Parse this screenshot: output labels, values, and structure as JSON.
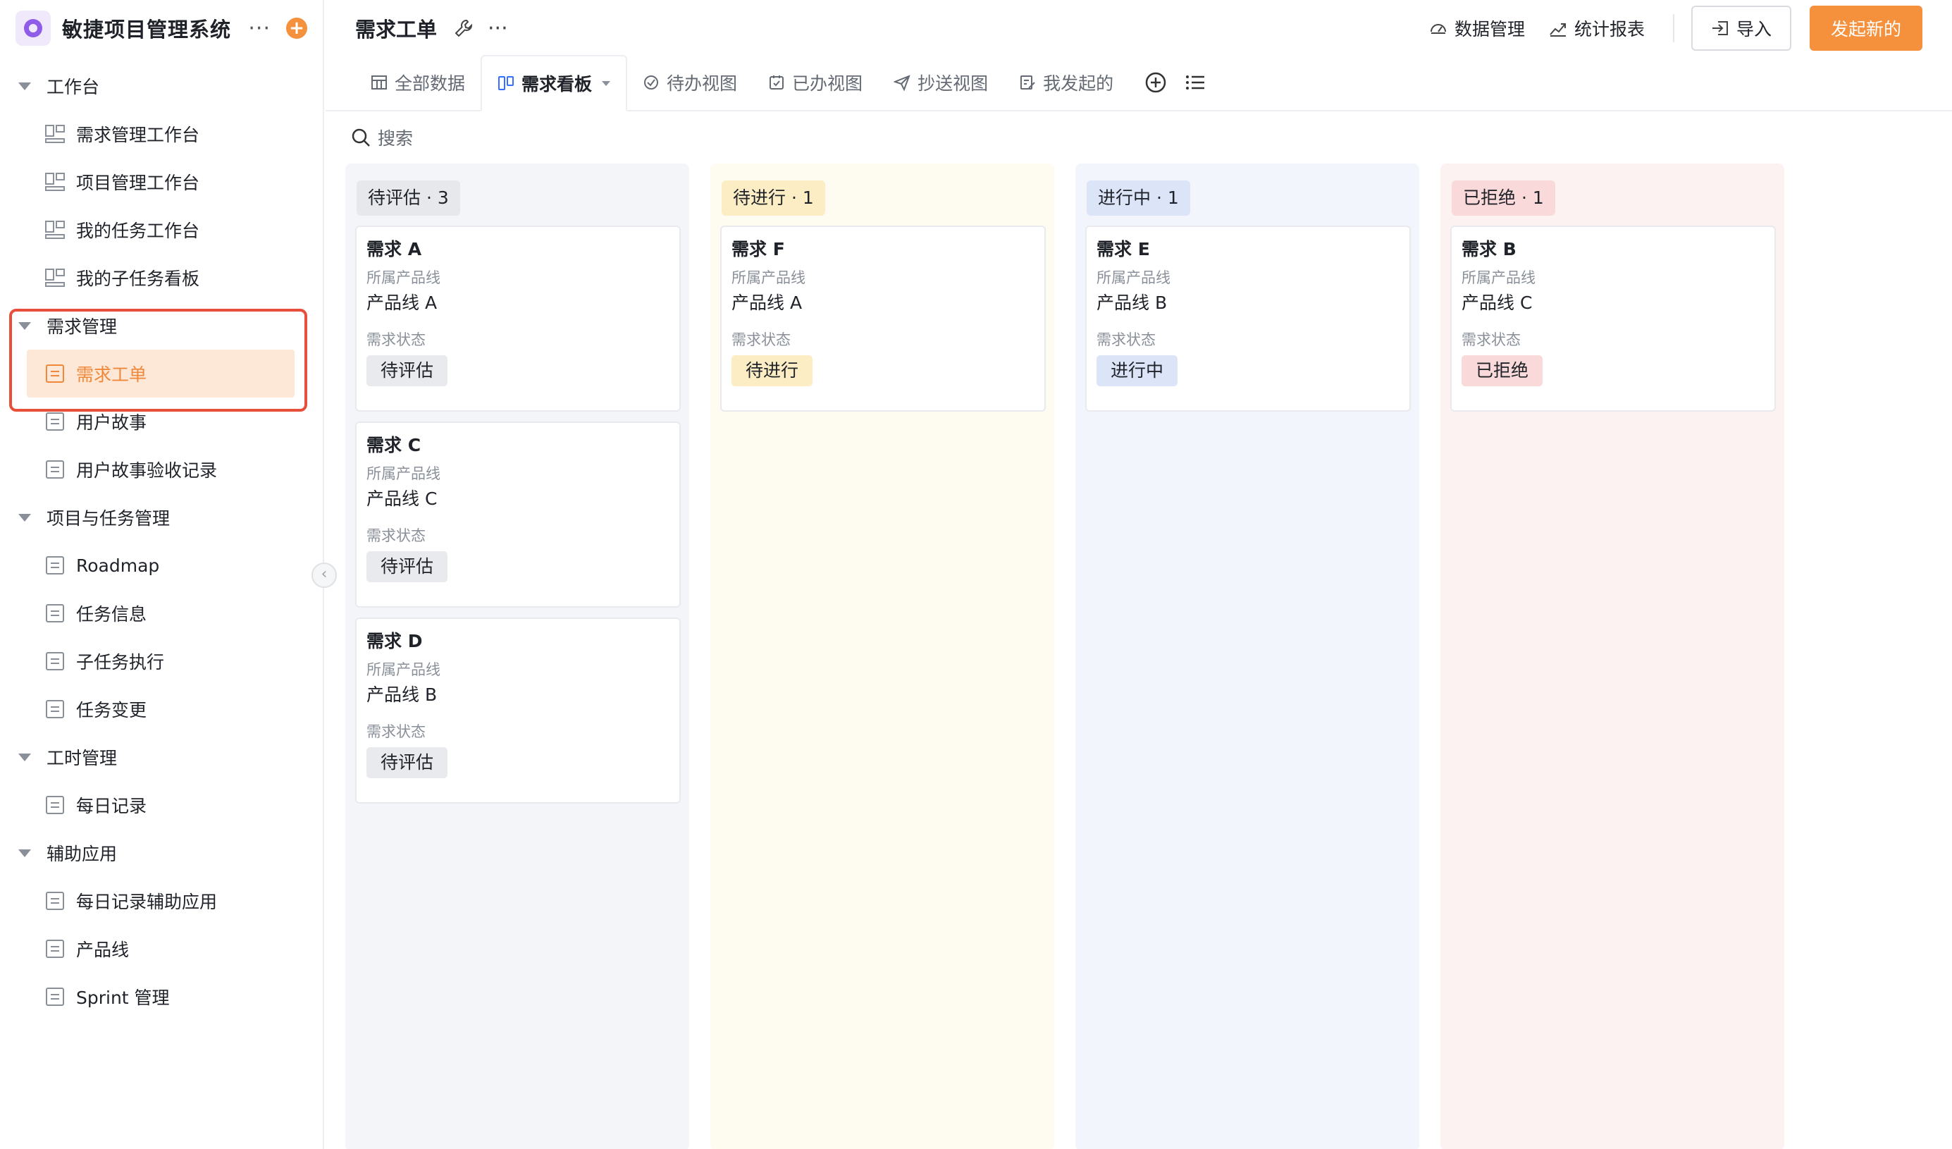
{
  "app": {
    "title": "敏捷项目管理系统"
  },
  "sidebar": {
    "groups": [
      {
        "label": "工作台",
        "items": [
          "需求管理工作台",
          "项目管理工作台",
          "我的任务工作台",
          "我的子任务看板"
        ]
      },
      {
        "label": "需求管理",
        "items": [
          "需求工单",
          "用户故事",
          "用户故事验收记录"
        ]
      },
      {
        "label": "项目与任务管理",
        "items": [
          "Roadmap",
          "任务信息",
          "子任务执行",
          "任务变更"
        ]
      },
      {
        "label": "工时管理",
        "items": [
          "每日记录"
        ]
      },
      {
        "label": "辅助应用",
        "items": [
          "每日记录辅助应用",
          "产品线",
          "Sprint 管理"
        ]
      }
    ],
    "active_item": "需求工单"
  },
  "header": {
    "title": "需求工单",
    "data_manage": "数据管理",
    "stats_report": "统计报表",
    "import_label": "导入",
    "primary_label": "发起新的"
  },
  "tabs": [
    "全部数据",
    "需求看板",
    "待办视图",
    "已办视图",
    "抄送视图",
    "我发起的"
  ],
  "active_tab": "需求看板",
  "search": {
    "label": "搜索"
  },
  "board": {
    "field_product": "所属产品线",
    "field_status": "需求状态",
    "columns": [
      {
        "title": "待评估 · 3",
        "color": "#e6e8eb",
        "cards": [
          {
            "name": "需求 A",
            "product": "产品线 A",
            "status": "待评估"
          },
          {
            "name": "需求 C",
            "product": "产品线 C",
            "status": "待评估"
          },
          {
            "name": "需求 D",
            "product": "产品线 B",
            "status": "待评估"
          }
        ]
      },
      {
        "title": "待进行 · 1",
        "color": "#fcedc4",
        "cards": [
          {
            "name": "需求 F",
            "product": "产品线 A",
            "status": "待进行"
          }
        ]
      },
      {
        "title": "进行中 · 1",
        "color": "#dce5f8",
        "cards": [
          {
            "name": "需求 E",
            "product": "产品线 B",
            "status": "进行中"
          }
        ]
      },
      {
        "title": "已拒绝 · 1",
        "color": "#f9d9d9",
        "cards": [
          {
            "name": "需求 B",
            "product": "产品线 C",
            "status": "已拒绝"
          }
        ]
      }
    ]
  },
  "colors": {
    "accent": "#f5913c",
    "highlight": "#e84f3a",
    "brand": "#8f5ce8"
  }
}
